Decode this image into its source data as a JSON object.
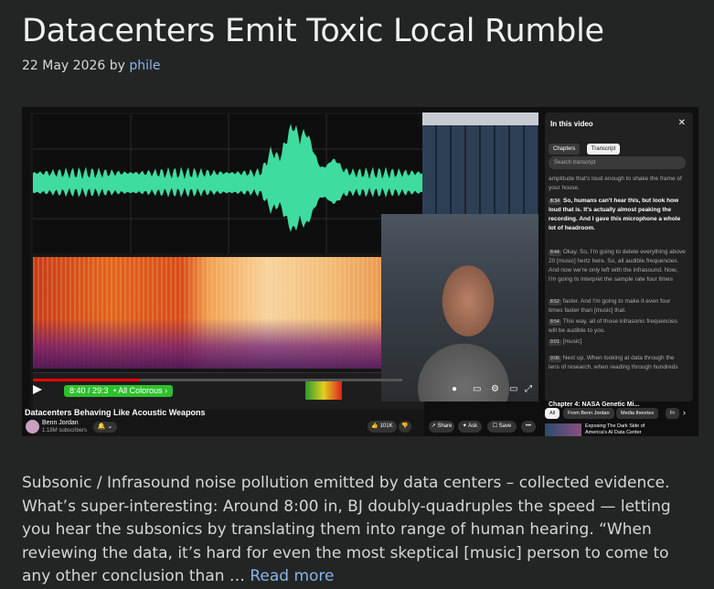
{
  "article": {
    "title": "Datacenters Emit Toxic Local Rumble",
    "date": "22 May 2026",
    "by_label": "by",
    "author": "phile",
    "body": "Subsonic / Infrasound noise pollution emitted by data centers – collected evidence. What’s super-interesting: Around 8:00 in, BJ doubly-quadruples the speed — letting you hear the subsonics by translating them into range of human hearing. “When reviewing the data, it’s hard for even the most skeptical [music] person to come to any other conclusion than …",
    "read_more": "Read more"
  },
  "video": {
    "title": "Datacenters Behaving Like Acoustic Weapons",
    "time": "8:40 / 29:34",
    "chapter": "• All Colorous ›",
    "progress_fraction": 0.29,
    "channel": "Benn Jordan",
    "subscribers": "1.18M subscribers",
    "likes": "101K",
    "share": "Share",
    "ask": "Ask",
    "save": "Save",
    "more": "•••",
    "bell": "🔔 ⌄"
  },
  "sidebar": {
    "heading": "In this video",
    "close": "✕",
    "tabs": [
      {
        "label": "Chapters",
        "active": false
      },
      {
        "label": "Transcript",
        "active": true
      }
    ],
    "search_placeholder": "Search transcript",
    "entries": [
      {
        "ts": "",
        "text": "amplitude that's loud enough to shake the frame of your house.",
        "highlight": false
      },
      {
        "ts": "8:34",
        "text": "So, humans can't hear this, but look how loud that is. It's actually almost peaking the recording. And I gave this microphone a whole lot of headroom.",
        "highlight": true
      },
      {
        "ts": "8:44",
        "text": "Okay. So, I'm going to delete everything above 20 [music] hertz here. So, all audible frequencies. And now we're only left with the infrasound. Now, I'm going to interpret the sample rate four times",
        "highlight": false
      },
      {
        "ts": "8:52",
        "text": "faster. And I'm going to make it even four times faster than [music] that.",
        "highlight": false
      },
      {
        "ts": "8:54",
        "text": "This way, all of those infrasonic frequencies will be audible to you.",
        "highlight": false
      },
      {
        "ts": "9:01",
        "text": "[music]",
        "highlight": false
      },
      {
        "ts": "9:06",
        "text": "Next up, When looking at data through the lens of research, when reading through hundreds",
        "highlight": false
      }
    ],
    "footer": "Chapter 4: NASA Genetic Mi..."
  },
  "chips": [
    {
      "label": "All",
      "active": true
    },
    {
      "label": "From Benn Jordan",
      "active": false
    },
    {
      "label": "Media theories",
      "active": false
    },
    {
      "label": "Fr",
      "active": false
    }
  ],
  "recommendation": {
    "title": "Exposing The Dark Side of America's AI Data Center"
  },
  "colors": {
    "page_bg": "#222524",
    "link": "#8ab4e8",
    "waveform": "#3fdca0",
    "progress": "#ff0000",
    "player_controls": "#2ec02e"
  }
}
